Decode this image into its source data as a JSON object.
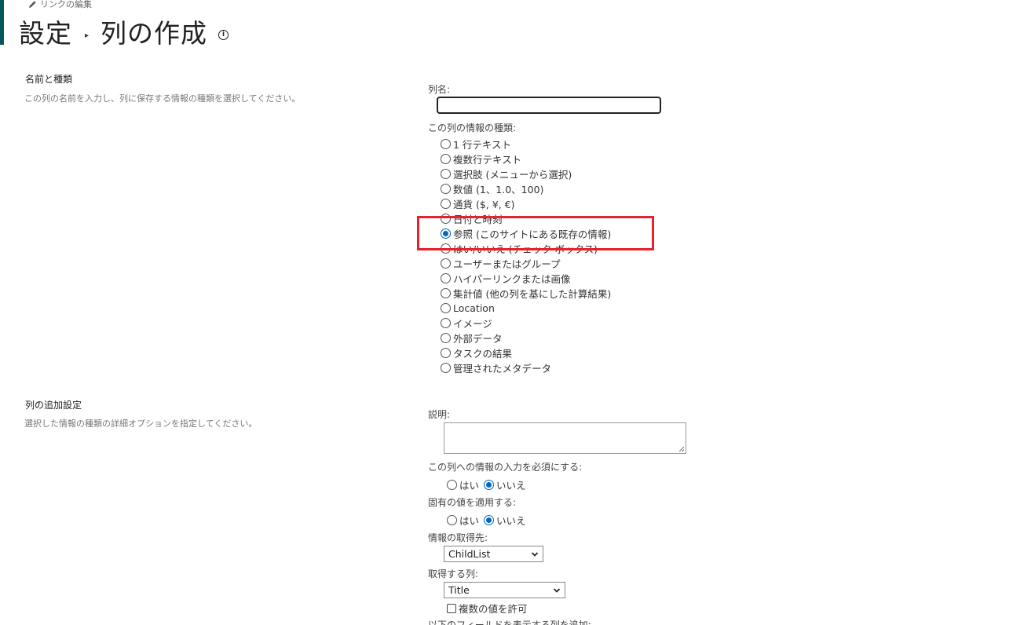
{
  "header": {
    "edit_links_label": "リンクの編集",
    "breadcrumb_parent": "設定",
    "breadcrumb_separator": "▸",
    "page_title": "列の作成",
    "info_glyph": "i"
  },
  "sections": {
    "name_type": {
      "title": "名前と種類",
      "description": "この列の名前を入力し、列に保存する情報の種類を選択してください。"
    },
    "additional": {
      "title": "列の追加設定",
      "description": "選択した情報の種類の詳細オプションを指定してください。"
    }
  },
  "form": {
    "column_name_label": "列名:",
    "column_name_value": "",
    "type_label": "この列の情報の種類:",
    "types": [
      {
        "label": "1 行テキスト",
        "checked": false
      },
      {
        "label": "複数行テキスト",
        "checked": false
      },
      {
        "label": "選択肢 (メニューから選択)",
        "checked": false
      },
      {
        "label": "数値 (1、1.0、100)",
        "checked": false
      },
      {
        "label": "通貨 ($, ¥, €)",
        "checked": false
      },
      {
        "label": "日付と時刻",
        "checked": false
      },
      {
        "label": "参照 (このサイトにある既存の情報)",
        "checked": true
      },
      {
        "label": "はい/いいえ (チェック ボックス)",
        "checked": false
      },
      {
        "label": "ユーザーまたはグループ",
        "checked": false
      },
      {
        "label": "ハイパーリンクまたは画像",
        "checked": false
      },
      {
        "label": "集計値 (他の列を基にした計算結果)",
        "checked": false
      },
      {
        "label": "Location",
        "checked": false
      },
      {
        "label": "イメージ",
        "checked": false
      },
      {
        "label": "外部データ",
        "checked": false
      },
      {
        "label": "タスクの結果",
        "checked": false
      },
      {
        "label": "管理されたメタデータ",
        "checked": false
      }
    ],
    "description_label": "説明:",
    "description_value": "",
    "required_label": "この列への情報の入力を必須にする:",
    "required_yes": "はい",
    "required_no": "いいえ",
    "required_value": "いいえ",
    "unique_label": "固有の値を適用する:",
    "unique_yes": "はい",
    "unique_no": "いいえ",
    "unique_value": "いいえ",
    "source_label": "情報の取得先:",
    "source_value": "ChildList",
    "column_label": "取得する列:",
    "column_value": "Title",
    "allow_multiple_label": "複数の値を許可",
    "allow_multiple_checked": false,
    "add_fields_label": "以下のフィールドを表示する列を追加:"
  },
  "annotation": {
    "highlight_color": "#e8212a"
  },
  "colors": {
    "accent": "#03585c",
    "radio_selected": "#0067c0"
  }
}
